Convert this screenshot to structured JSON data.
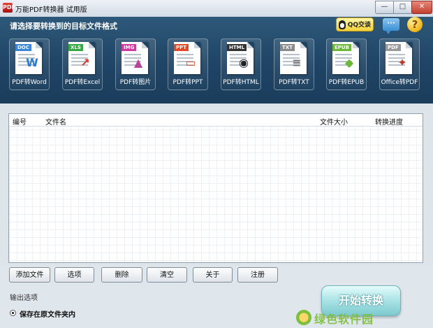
{
  "window": {
    "app_icon_text": "PDF",
    "title": "万能PDF转换器 试用版",
    "min_glyph": "—",
    "max_glyph": "□",
    "close_glyph": "✕"
  },
  "header": {
    "prompt": "请选择要转换到的目标文件格式",
    "qq_label": "QQ交谈",
    "chat_glyph": "···",
    "help_glyph": "?"
  },
  "formats": [
    {
      "tag": "DOC",
      "tag_color": "#3a86d8",
      "glyph": "W",
      "glyph_color": "#2b7bd1",
      "label": "PDF转Word"
    },
    {
      "tag": "XLS",
      "tag_color": "#35a843",
      "glyph": "↗",
      "glyph_color": "#d8322a",
      "label": "PDF转Excel"
    },
    {
      "tag": "IMG",
      "tag_color": "#d03aa0",
      "glyph": "▲",
      "glyph_color": "#b7459b",
      "label": "PDF转图片"
    },
    {
      "tag": "PPT",
      "tag_color": "#e04a27",
      "glyph": "▭",
      "glyph_color": "#d9542f",
      "label": "PDF转PPT"
    },
    {
      "tag": "HTML",
      "tag_color": "#333333",
      "glyph": "◉",
      "glyph_color": "#222222",
      "label": "PDF转HTML"
    },
    {
      "tag": "TXT",
      "tag_color": "#8a8a8a",
      "glyph": "≡",
      "glyph_color": "#777777",
      "label": "PDF转TXT"
    },
    {
      "tag": "EPUB",
      "tag_color": "#6bb83a",
      "glyph": "◆",
      "glyph_color": "#6bb83a",
      "label": "PDF转EPUB"
    },
    {
      "tag": "PDF",
      "tag_color": "#9a9a9a",
      "glyph": "✦",
      "glyph_color": "#c0392b",
      "label": "Office转PDF"
    }
  ],
  "table": {
    "columns": [
      "编号",
      "文件名",
      "文件大小",
      "转换进度"
    ],
    "rows": []
  },
  "buttons": {
    "add_file": "添加文件",
    "options": "选项",
    "delete": "删除",
    "clear": "清空",
    "about": "关于",
    "register": "注册"
  },
  "output": {
    "title": "输出选项",
    "save_in_original": "保存在原文件夹内"
  },
  "start_label": "开始转换",
  "watermark_text": "绿色软件园"
}
